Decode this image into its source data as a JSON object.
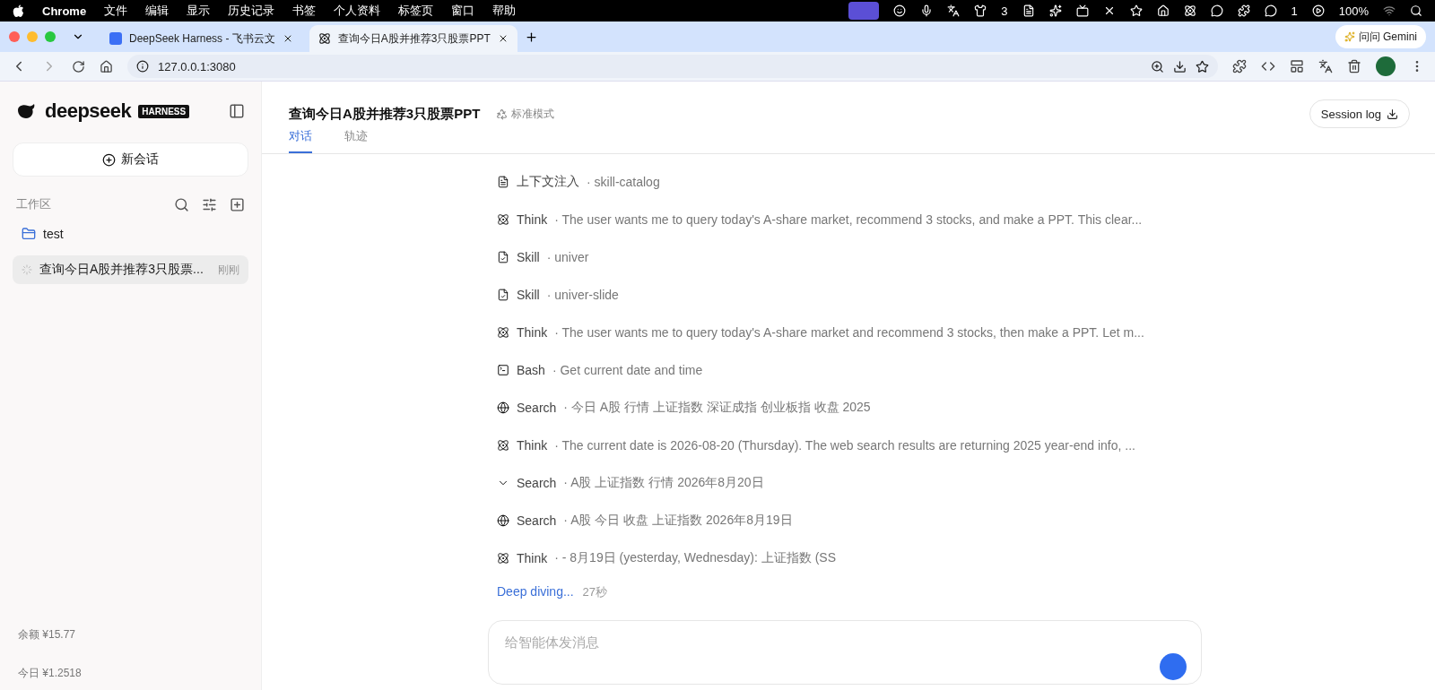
{
  "menu_bar": {
    "app": "Chrome",
    "menus": [
      "文件",
      "编辑",
      "显示",
      "历史记录",
      "书签",
      "个人资料",
      "标签页",
      "窗口",
      "帮助"
    ],
    "badges": [
      "3",
      "1"
    ],
    "battery": "100%"
  },
  "browser": {
    "tabs": [
      {
        "title": "DeepSeek Harness - 飞书云文",
        "selected": false
      },
      {
        "title": "查询今日A股并推荐3只股票PPT",
        "selected": true
      }
    ],
    "url": "127.0.0.1:3080",
    "gemini": "问问 Gemini"
  },
  "sidebar": {
    "brand": "deepseek",
    "brand_tag": "HARNESS",
    "new_chat": "新会话",
    "workspace_label": "工作区",
    "items": [
      {
        "kind": "folder",
        "label": "test",
        "selected": false
      },
      {
        "kind": "session",
        "label": "查询今日A股并推荐3只股票...",
        "time": "刚刚",
        "selected": true
      }
    ],
    "balance": "余额 ¥15.77",
    "today": "今日 ¥1.2518"
  },
  "header": {
    "title": "查询今日A股并推荐3只股票PPT",
    "mode": "标准模式",
    "session_log": "Session log",
    "tabs": [
      {
        "label": "对话",
        "selected": true
      },
      {
        "label": "轨迹",
        "selected": false
      }
    ]
  },
  "steps": [
    {
      "kind": "context",
      "name": "上下文注入",
      "detail": "· skill-catalog",
      "hovered": false
    },
    {
      "kind": "think",
      "name": "Think",
      "detail": "· The user wants me to query today's A-share market, recommend 3 stocks, and make a PPT. This clear...",
      "hovered": false
    },
    {
      "kind": "skill",
      "name": "Skill",
      "detail": "· univer",
      "hovered": false
    },
    {
      "kind": "skill",
      "name": "Skill",
      "detail": "· univer-slide",
      "hovered": false
    },
    {
      "kind": "think",
      "name": "Think",
      "detail": "· The user wants me to query today's A-share market and recommend 3 stocks, then make a PPT. Let m...",
      "hovered": false
    },
    {
      "kind": "bash",
      "name": "Bash",
      "detail": "· Get current date and time",
      "hovered": false
    },
    {
      "kind": "search",
      "name": "Search",
      "detail": "· 今日 A股 行情 上证指数 深证成指 创业板指 收盘 2025",
      "hovered": false
    },
    {
      "kind": "think",
      "name": "Think",
      "detail": "· The current date is 2026-08-20 (Thursday). The web search results are returning 2025 year-end info, ...",
      "hovered": false
    },
    {
      "kind": "search",
      "name": "Search",
      "detail": "· A股 上证指数 行情 2026年8月20日",
      "hovered": true
    },
    {
      "kind": "search",
      "name": "Search",
      "detail": "· A股 今日 收盘 上证指数 2026年8月19日",
      "hovered": false
    },
    {
      "kind": "think",
      "name": "Think",
      "detail": "· - 8月19日 (yesterday, Wednesday): 上证指数 (SS",
      "hovered": false
    }
  ],
  "status": {
    "label": "Deep diving...",
    "elapsed": "27秒"
  },
  "composer": {
    "placeholder": "给智能体发消息"
  }
}
